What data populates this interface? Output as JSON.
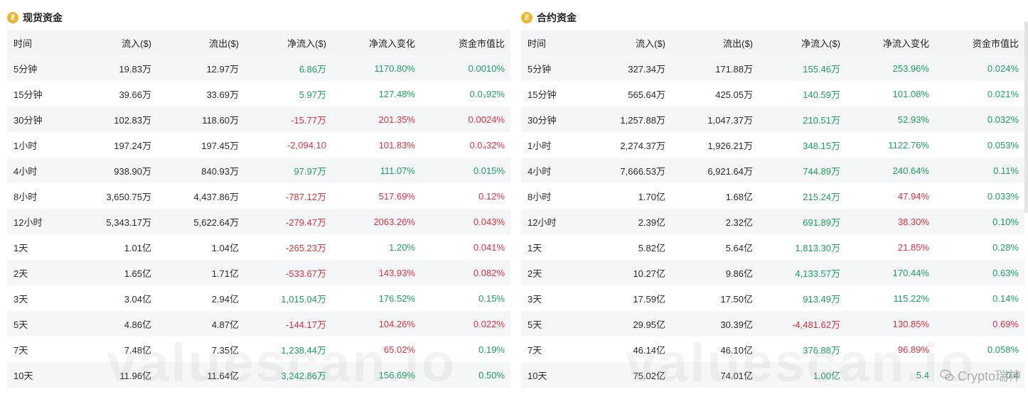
{
  "spot": {
    "title": "现货资金",
    "coin_icon": "coin-icon",
    "headers": [
      "时间",
      "流入($)",
      "流出($)",
      "净流入($)",
      "净流入变化",
      "资金市值比"
    ],
    "rows": [
      [
        "5分钟",
        "19.83万",
        "12.97万",
        "6.86万",
        "1170.80%",
        "0.0010%"
      ],
      [
        "15分钟",
        "39.66万",
        "33.69万",
        "5.97万",
        "127.48%",
        "0.0₃92%"
      ],
      [
        "30分钟",
        "102.83万",
        "118.60万",
        "-15.77万",
        "201.35%",
        "0.0024%"
      ],
      [
        "1小时",
        "197.24万",
        "197.45万",
        "-2,094.10",
        "101.83%",
        "0.0₄32%"
      ],
      [
        "4小时",
        "938.90万",
        "840.93万",
        "97.97万",
        "111.07%",
        "0.015%"
      ],
      [
        "8小时",
        "3,650.75万",
        "4,437.86万",
        "-787.12万",
        "517.69%",
        "0.12%"
      ],
      [
        "12小时",
        "5,343.17万",
        "5,622.64万",
        "-279.47万",
        "2063.26%",
        "0.043%"
      ],
      [
        "1天",
        "1.01亿",
        "1.04亿",
        "-265.23万",
        "1.20%",
        "0.041%"
      ],
      [
        "2天",
        "1.65亿",
        "1.71亿",
        "-533.67万",
        "143.93%",
        "0.082%"
      ],
      [
        "3天",
        "3.04亿",
        "2.94亿",
        "1,015.04万",
        "176.52%",
        "0.15%"
      ],
      [
        "5天",
        "4.86亿",
        "4.87亿",
        "-144.17万",
        "104.26%",
        "0.022%"
      ],
      [
        "7天",
        "7.48亿",
        "7.35亿",
        "1,238.44万",
        "65.02%",
        "0.19%"
      ],
      [
        "10天",
        "11.96亿",
        "11.64亿",
        "3,242.86万",
        "156.69%",
        "0.50%"
      ]
    ],
    "colors": [
      [
        "",
        "",
        "",
        "pos",
        "pos",
        "pos"
      ],
      [
        "",
        "",
        "",
        "pos",
        "pos",
        "pos"
      ],
      [
        "",
        "",
        "",
        "neg",
        "neg",
        "neg"
      ],
      [
        "",
        "",
        "",
        "neg",
        "neg",
        "neg"
      ],
      [
        "",
        "",
        "",
        "pos",
        "pos",
        "pos"
      ],
      [
        "",
        "",
        "",
        "neg",
        "neg",
        "neg"
      ],
      [
        "",
        "",
        "",
        "neg",
        "neg",
        "neg"
      ],
      [
        "",
        "",
        "",
        "neg",
        "pos",
        "neg"
      ],
      [
        "",
        "",
        "",
        "neg",
        "neg",
        "neg"
      ],
      [
        "",
        "",
        "",
        "pos",
        "pos",
        "pos"
      ],
      [
        "",
        "",
        "",
        "neg",
        "neg",
        "neg"
      ],
      [
        "",
        "",
        "",
        "pos",
        "neg",
        "pos"
      ],
      [
        "",
        "",
        "",
        "pos",
        "pos",
        "pos"
      ]
    ]
  },
  "futures": {
    "title": "合约资金",
    "coin_icon": "coin-icon",
    "headers": [
      "时间",
      "流入($)",
      "流出($)",
      "净流入($)",
      "净流入变化",
      "资金市值比"
    ],
    "rows": [
      [
        "5分钟",
        "327.34万",
        "171.88万",
        "155.46万",
        "253.96%",
        "0.024%"
      ],
      [
        "15分钟",
        "565.64万",
        "425.05万",
        "140.59万",
        "101.08%",
        "0.021%"
      ],
      [
        "30分钟",
        "1,257.88万",
        "1,047.37万",
        "210.51万",
        "52.93%",
        "0.032%"
      ],
      [
        "1小时",
        "2,274.37万",
        "1,926.21万",
        "348.15万",
        "1122.76%",
        "0.053%"
      ],
      [
        "4小时",
        "7,666.53万",
        "6,921.64万",
        "744.89万",
        "240.64%",
        "0.11%"
      ],
      [
        "8小时",
        "1.70亿",
        "1.68亿",
        "215.24万",
        "47.94%",
        "0.033%"
      ],
      [
        "12小时",
        "2.39亿",
        "2.32亿",
        "691.89万",
        "38.30%",
        "0.10%"
      ],
      [
        "1天",
        "5.82亿",
        "5.64亿",
        "1,813.30万",
        "21.85%",
        "0.28%"
      ],
      [
        "2天",
        "10.27亿",
        "9.86亿",
        "4,133.57万",
        "170.44%",
        "0.63%"
      ],
      [
        "3天",
        "17.59亿",
        "17.50亿",
        "913.49万",
        "115.22%",
        "0.14%"
      ],
      [
        "5天",
        "29.95亿",
        "30.39亿",
        "-4,481.62万",
        "130.85%",
        "0.69%"
      ],
      [
        "7天",
        "46.14亿",
        "46.10亿",
        "376.88万",
        "96.89%",
        "0.058%"
      ],
      [
        "10天",
        "75.02亿",
        "74.01亿",
        "1.00亿",
        "5.4",
        "0.4"
      ]
    ],
    "colors": [
      [
        "",
        "",
        "",
        "pos",
        "pos",
        "pos"
      ],
      [
        "",
        "",
        "",
        "pos",
        "pos",
        "pos"
      ],
      [
        "",
        "",
        "",
        "pos",
        "pos",
        "pos"
      ],
      [
        "",
        "",
        "",
        "pos",
        "pos",
        "pos"
      ],
      [
        "",
        "",
        "",
        "pos",
        "pos",
        "pos"
      ],
      [
        "",
        "",
        "",
        "pos",
        "neg",
        "pos"
      ],
      [
        "",
        "",
        "",
        "pos",
        "neg",
        "pos"
      ],
      [
        "",
        "",
        "",
        "pos",
        "neg",
        "pos"
      ],
      [
        "",
        "",
        "",
        "pos",
        "pos",
        "pos"
      ],
      [
        "",
        "",
        "",
        "pos",
        "pos",
        "pos"
      ],
      [
        "",
        "",
        "",
        "neg",
        "neg",
        "neg"
      ],
      [
        "",
        "",
        "",
        "pos",
        "neg",
        "pos"
      ],
      [
        "",
        "",
        "",
        "pos",
        "pos",
        "pos"
      ]
    ]
  },
  "watermark": "valuescan.io",
  "credit": "Crypto瑞神",
  "credit_icon": "wechat-icon",
  "palette": {
    "positive": "#1aa35b",
    "negative": "#e5303e",
    "coin": "#f0b429",
    "row_alt": "#f5f6f8"
  }
}
